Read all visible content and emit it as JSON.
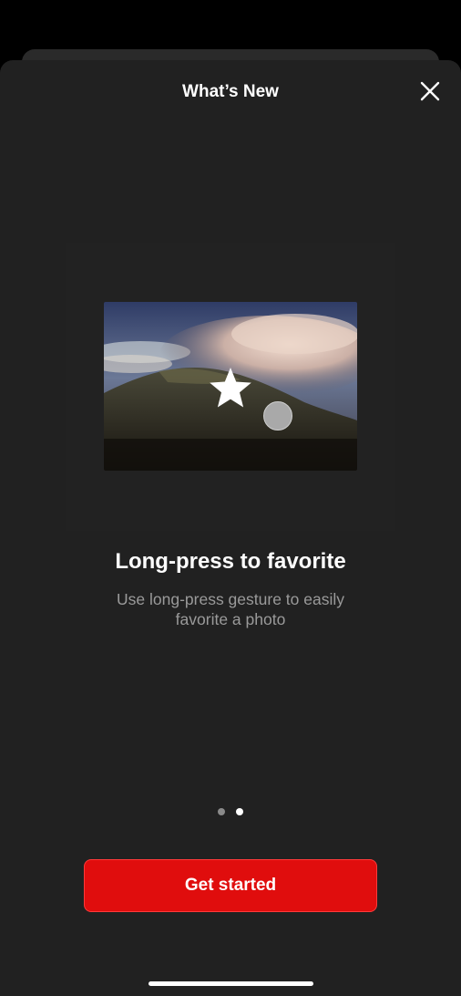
{
  "header": {
    "title": "What’s New",
    "close_icon": "close-icon"
  },
  "feature": {
    "title": "Long-press to favorite",
    "description": "Use long-press gesture to easily favorite a photo",
    "illustration_icons": [
      "star-icon",
      "touch-indicator"
    ]
  },
  "pager": {
    "total": 2,
    "active_index": 1
  },
  "cta": {
    "label": "Get started"
  },
  "colors": {
    "sheet_background": "#212121",
    "cta_red": "#e00d0d",
    "description_gray": "#9a9a9a"
  }
}
